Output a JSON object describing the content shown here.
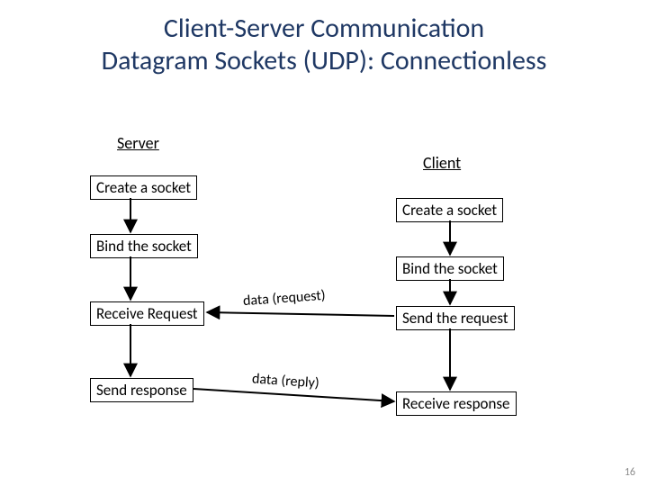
{
  "title_line1": "Client-Server Communication",
  "title_line2": "Datagram Sockets (UDP): Connectionless",
  "server_label": "Server",
  "client_label": "Client",
  "server_steps": [
    "Create a socket",
    "Bind the socket",
    "Receive Request",
    "Send response"
  ],
  "client_steps": [
    "Create a socket",
    "Bind the socket",
    "Send the request",
    "Receive response"
  ],
  "edge_request": "data (request)",
  "edge_reply": "data (reply)",
  "page_number": "16"
}
